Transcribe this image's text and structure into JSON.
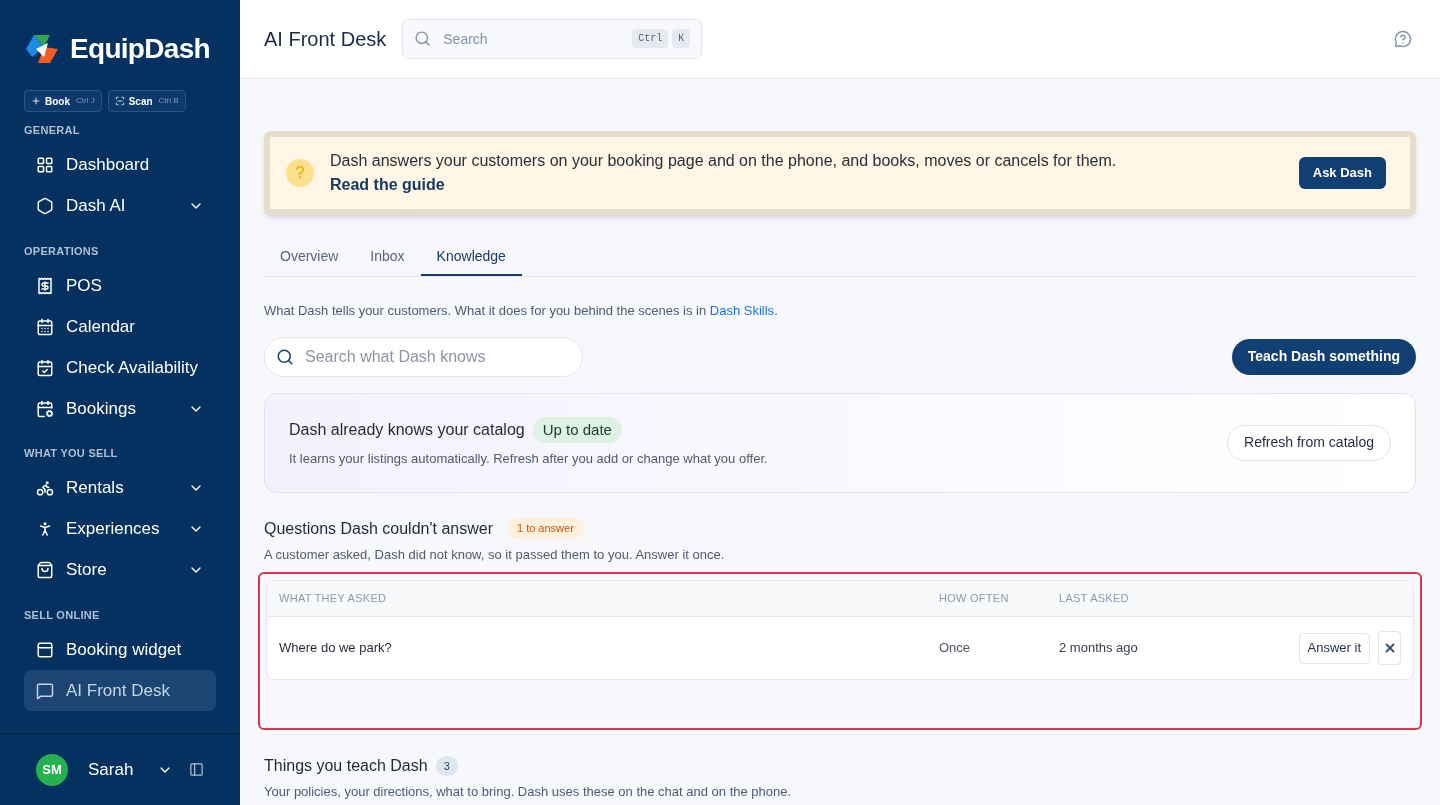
{
  "brand": {
    "name": "EquipDash"
  },
  "quick_actions": [
    {
      "label": "Book",
      "shortcut": "Ctrl J"
    },
    {
      "label": "Scan",
      "shortcut": "Ctrl B"
    }
  ],
  "sidebar": {
    "sections": [
      {
        "title": "GENERAL",
        "items": [
          {
            "label": "Dashboard",
            "expandable": false,
            "selected": false
          },
          {
            "label": "Dash AI",
            "expandable": true,
            "selected": false
          }
        ]
      },
      {
        "title": "OPERATIONS",
        "items": [
          {
            "label": "POS",
            "expandable": false,
            "selected": false
          },
          {
            "label": "Calendar",
            "expandable": false,
            "selected": false
          },
          {
            "label": "Check Availability",
            "expandable": false,
            "selected": false
          },
          {
            "label": "Bookings",
            "expandable": true,
            "selected": false
          }
        ]
      },
      {
        "title": "WHAT YOU SELL",
        "items": [
          {
            "label": "Rentals",
            "expandable": true,
            "selected": false
          },
          {
            "label": "Experiences",
            "expandable": true,
            "selected": false
          },
          {
            "label": "Store",
            "expandable": true,
            "selected": false
          }
        ]
      },
      {
        "title": "SELL ONLINE",
        "items": [
          {
            "label": "Booking widget",
            "expandable": false,
            "selected": false
          },
          {
            "label": "AI Front Desk",
            "expandable": false,
            "selected": true
          }
        ]
      }
    ]
  },
  "user": {
    "initials": "SM",
    "name": "Sarah"
  },
  "header": {
    "title": "AI Front Desk",
    "search": {
      "placeholder": "Search",
      "keys": [
        "Ctrl",
        "K"
      ]
    }
  },
  "banner": {
    "icon_text": "?",
    "text": "Dash answers your customers on your booking page and on the phone, and books, moves or cancels for them.",
    "link": "Read the guide",
    "button": "Ask Dash"
  },
  "tabs": [
    {
      "label": "Overview",
      "selected": false
    },
    {
      "label": "Inbox",
      "selected": false
    },
    {
      "label": "Knowledge",
      "selected": true
    }
  ],
  "knowledge": {
    "intro": "What Dash tells your customers. What it does for you behind the scenes is in ",
    "intro_link": "Dash Skills",
    "intro_end": ".",
    "search": {
      "placeholder": "Search what Dash knows"
    },
    "teach_button": "Teach Dash something",
    "catalog": {
      "title": "Dash already knows your catalog",
      "status": "Up to date",
      "description": "It learns your listings automatically. Refresh after you add or change what you offer.",
      "button": "Refresh from catalog"
    },
    "questions": {
      "title": "Questions Dash couldn't answer",
      "badge": "1 to answer",
      "description": "A customer asked, Dash did not know, so it passed them to you. Answer it once.",
      "highlighted": true,
      "columns": [
        "WHAT THEY ASKED",
        "HOW OFTEN",
        "LAST ASKED"
      ],
      "rows": [
        {
          "question": "Where do we park?",
          "how_often": "Once",
          "last_asked": "2 months ago",
          "action": "Answer it"
        }
      ]
    },
    "taught": {
      "title": "Things you teach Dash",
      "count": "3",
      "description": "Your policies, your directions, what to bring. Dash uses these on the chat and on the phone."
    }
  }
}
